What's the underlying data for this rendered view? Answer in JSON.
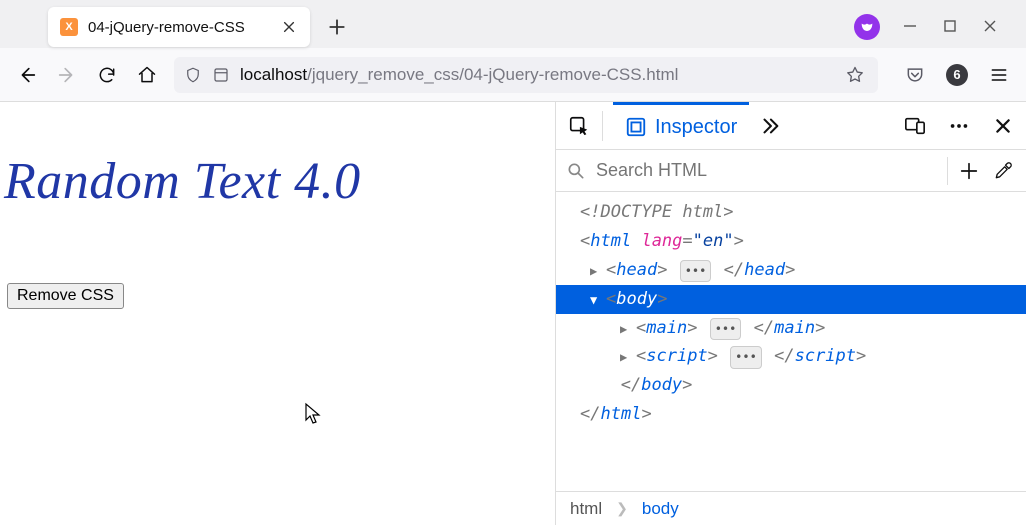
{
  "tab": {
    "favicon_letter": "X",
    "title": "04-jQuery-remove-CSS"
  },
  "toolbar": {
    "badge_count": "6"
  },
  "url": {
    "host": "localhost",
    "path": "/jquery_remove_css/04-jQuery-remove-CSS.html"
  },
  "page": {
    "heading": "Random Text 4.0",
    "button_label": "Remove CSS"
  },
  "devtools": {
    "tab_label": "Inspector",
    "search_placeholder": "Search HTML",
    "dom": {
      "doctype": "<!DOCTYPE html>",
      "html_open": "html",
      "lang_attr": "lang",
      "lang_val": "\"en\"",
      "head": "head",
      "body": "body",
      "main": "main",
      "script": "script"
    },
    "breadcrumbs": {
      "root": "html",
      "current": "body"
    }
  }
}
